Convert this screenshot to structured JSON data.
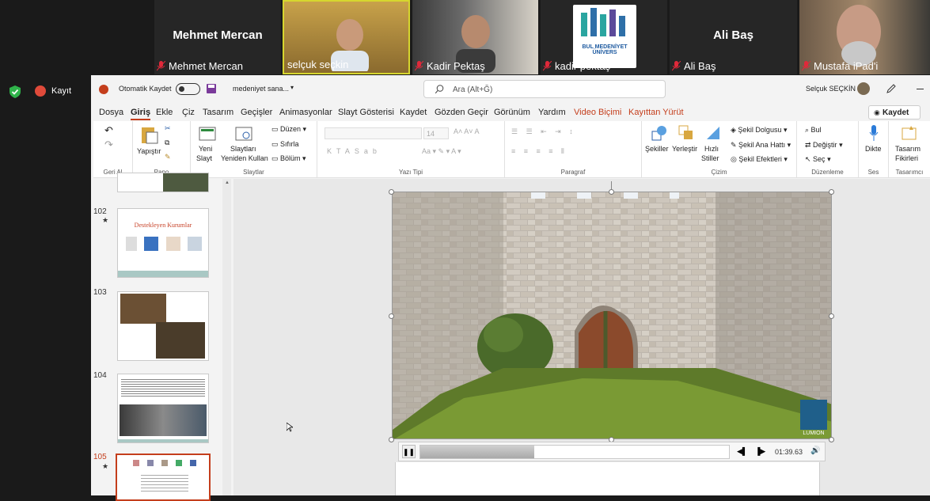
{
  "participants": [
    {
      "tile": "Mehmet Mercan",
      "name": "Mehmet Mercan"
    },
    {
      "tile": "",
      "name": "selçuk seçkin"
    },
    {
      "tile": "",
      "name": "Kadir Pektaş"
    },
    {
      "tile": "",
      "name": "kadir pektaş"
    },
    {
      "tile": "Ali Baş",
      "name": "Ali Baş"
    },
    {
      "tile": "",
      "name": "Mustafa iPad'i"
    }
  ],
  "logo_text": "BUL MEDENİYET ÜNİVERS",
  "zoom": {
    "record_label": "Kayıt"
  },
  "titlebar": {
    "autosave": "Otomatik Kaydet",
    "filename": "medeniyet sana...",
    "search": "Ara (Alt+Ğ)",
    "user": "Selçuk SEÇKİN"
  },
  "menu": {
    "items": [
      "Dosya",
      "Giriş",
      "Ekle",
      "Çiz",
      "Tasarım",
      "Geçişler",
      "Animasyonlar",
      "Slayt Gösterisi",
      "Kaydet",
      "Gözden Geçir",
      "Görünüm",
      "Yardım"
    ],
    "video": "Video Biçimi",
    "record": "Kayıttan Yürüt",
    "save_btn": "Kaydet"
  },
  "ribbon": {
    "undo": "Geri Al",
    "paste": "Yapıştır",
    "pano": "Pano",
    "new_slide": "Yeni",
    "new_slide2": "Slayt",
    "reuse": "Slaytları",
    "reuse2": "Yeniden Kullan",
    "layout": "Düzen",
    "reset": "Sıfırla",
    "section": "Bölüm",
    "slides": "Slaytlar",
    "font_size": "14",
    "font_group": "Yazı Tipi",
    "para_group": "Paragraf",
    "shapes": "Şekiller",
    "arrange": "Yerleştir",
    "quick": "Hızlı",
    "styles": "Stiller",
    "fill": "Şekil Dolgusu",
    "outline": "Şekil Ana Hattı",
    "effects": "Şekil Efektleri",
    "draw_group": "Çizim",
    "find": "Bul",
    "replace": "Değiştir",
    "select": "Seç",
    "edit_group": "Düzenleme",
    "dictate": "Dikte",
    "voice_group": "Ses",
    "designer": "Tasarım",
    "designer2": "Fikirleri",
    "designer_group": "Tasarımcı"
  },
  "slides": [
    {
      "num": "102",
      "title": "Destekleyen Kurumlar"
    },
    {
      "num": "103"
    },
    {
      "num": "104"
    },
    {
      "num": "105"
    }
  ],
  "video": {
    "time": "01:39.63",
    "progress": 0.37,
    "watermark": "LUMION"
  }
}
